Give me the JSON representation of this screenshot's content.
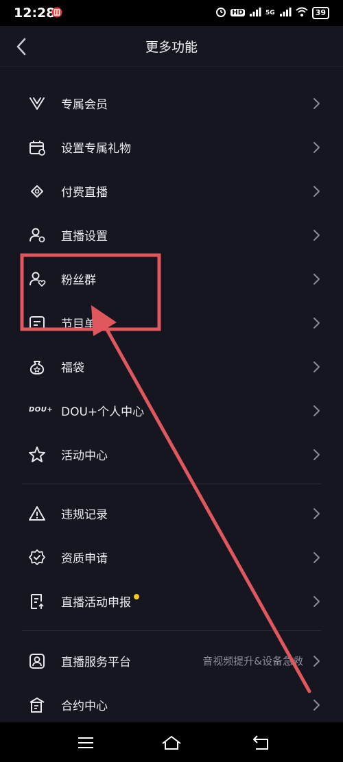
{
  "status": {
    "time": "12:28",
    "battery": "39",
    "net1": "HD",
    "net2": "5G"
  },
  "header": {
    "title": "更多功能"
  },
  "menu": {
    "items": [
      {
        "label": "专属会员",
        "icon": "vip-v-icon"
      },
      {
        "label": "设置专属礼物",
        "icon": "gift-calendar-icon"
      },
      {
        "label": "付费直播",
        "icon": "ticket-icon"
      },
      {
        "label": "直播设置",
        "icon": "user-settings-icon"
      },
      {
        "label": "粉丝群",
        "icon": "user-heart-icon"
      },
      {
        "label": "节目单",
        "icon": "program-list-icon"
      },
      {
        "label": "福袋",
        "icon": "lucky-bag-icon"
      },
      {
        "label": "DOU+个人中心",
        "icon": "dou-plus-logo"
      },
      {
        "label": "活动中心",
        "icon": "star-icon"
      },
      {
        "label": "违规记录",
        "icon": "warning-icon"
      },
      {
        "label": "资质申请",
        "icon": "badge-check-icon"
      },
      {
        "label": "直播活动申报",
        "icon": "document-upload-icon",
        "badge": "new-dot"
      },
      {
        "label": "直播服务平台",
        "icon": "service-user-icon",
        "sub": "音视频提升&设备急救"
      },
      {
        "label": "合约中心",
        "icon": "contract-building-icon"
      }
    ],
    "dou_logo_text": "DOU+"
  },
  "colors": {
    "background": "#15161f",
    "annotation": "#e0575d",
    "dot": "#f5c518"
  }
}
